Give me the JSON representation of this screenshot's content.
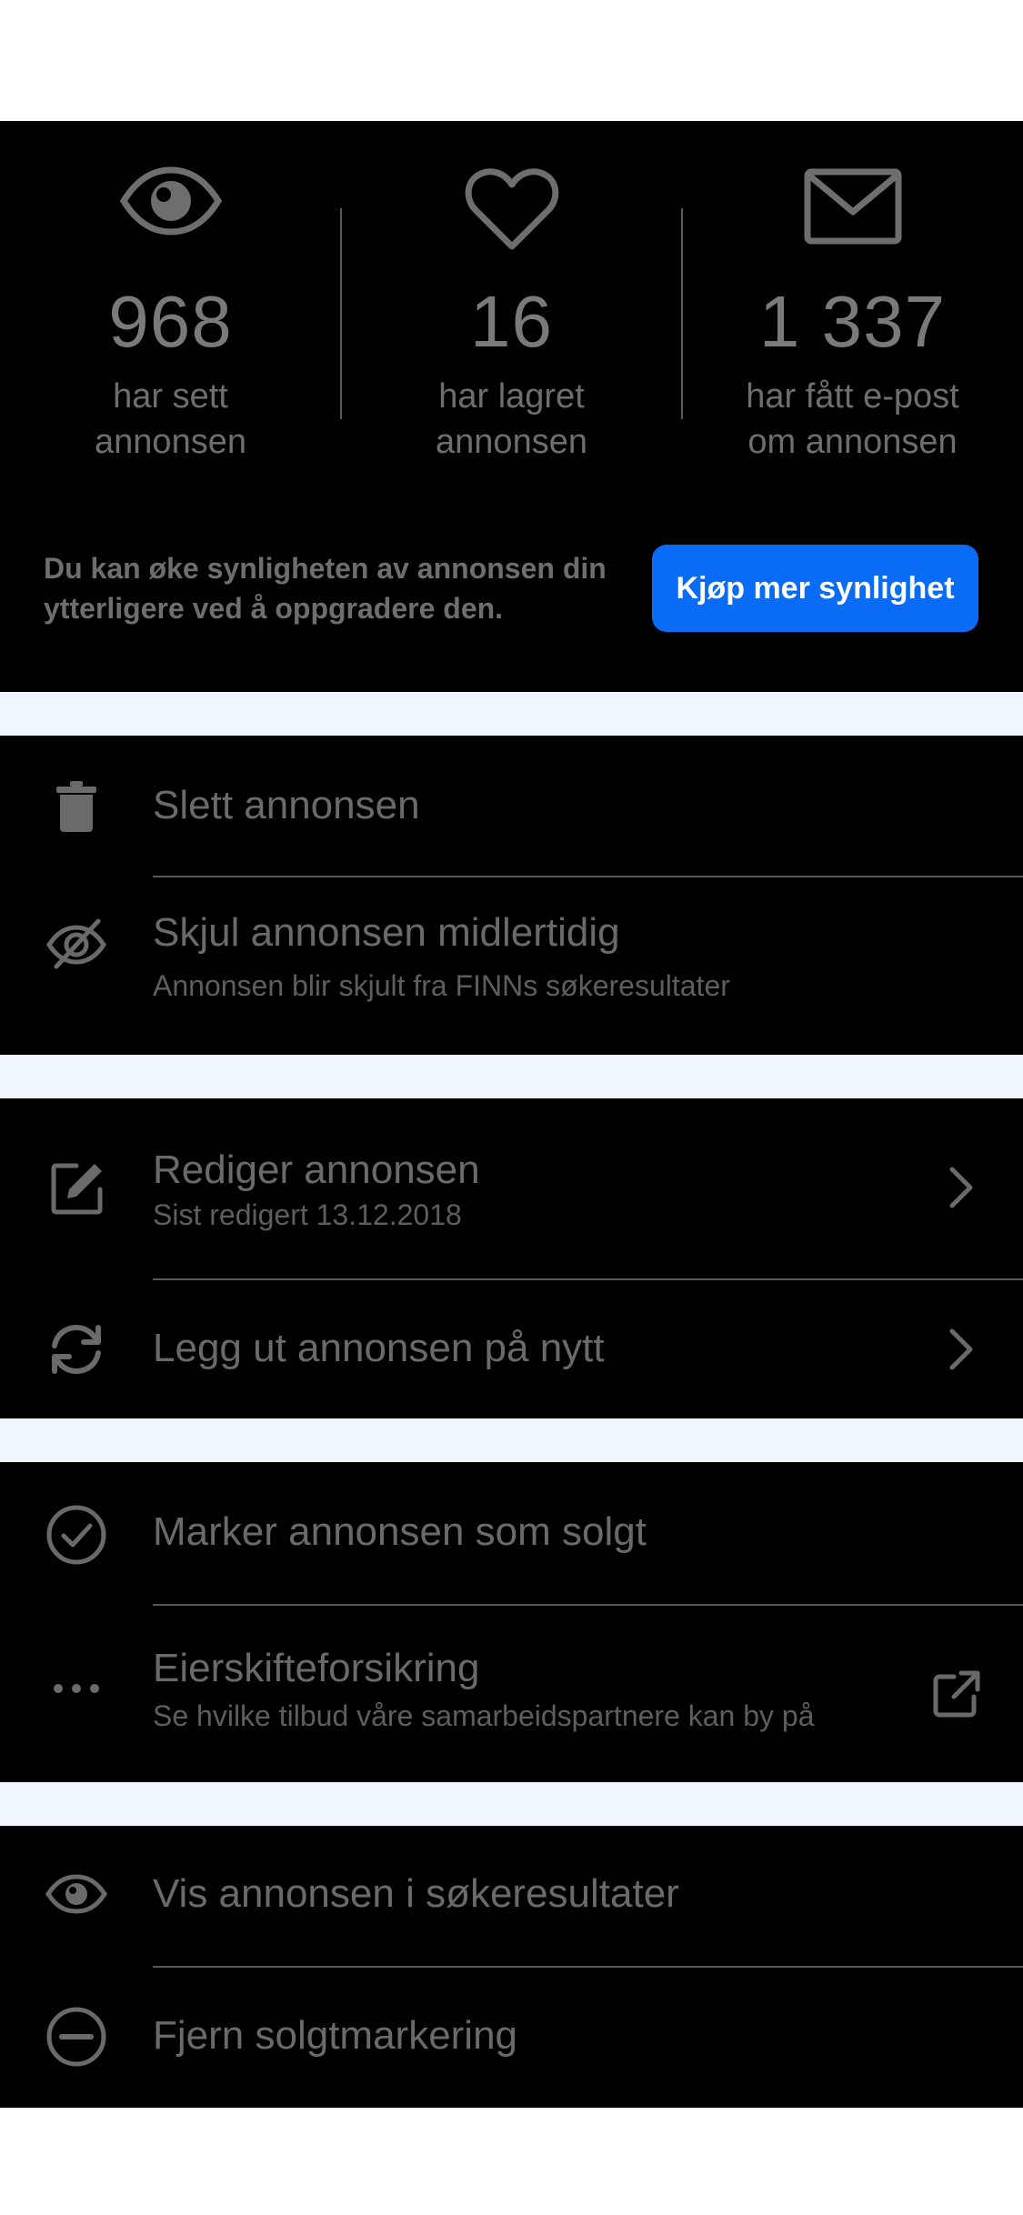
{
  "stats": [
    {
      "icon": "eye-icon",
      "value": "968",
      "label_line1": "har sett",
      "label_line2": "annonsen"
    },
    {
      "icon": "heart-icon",
      "value": "16",
      "label_line1": "har lagret",
      "label_line2": "annonsen"
    },
    {
      "icon": "envelope-icon",
      "value": "1 337",
      "label_line1": "har fått e-post",
      "label_line2": "om annonsen"
    }
  ],
  "promo": {
    "text": "Du kan øke synligheten av annonsen din ytterligere ved å oppgradere den.",
    "button_label": "Kjøp mer synlighet"
  },
  "actions": {
    "delete": {
      "title": "Slett annonsen"
    },
    "hide": {
      "title": "Skjul annonsen midlertidig",
      "subtitle": "Annonsen blir skjult fra FINNs søkeresultater"
    },
    "edit": {
      "title": "Rediger annonsen",
      "subtitle": "Sist redigert 13.12.2018"
    },
    "republish": {
      "title": "Legg ut annonsen på nytt"
    },
    "mark_sold": {
      "title": "Marker annonsen som solgt"
    },
    "insurance": {
      "title": "Eierskifteforsikring",
      "subtitle": "Se hvilke tilbud våre samarbeidspartnere kan by på"
    },
    "show_in_results": {
      "title": "Vis annonsen i søkeresultater"
    },
    "remove_sold": {
      "title": "Fjern solgtmarkering"
    }
  },
  "colors": {
    "accent": "#0a6cf5",
    "background": "#000000",
    "separator": "#eef5fd",
    "text": "#6a6a6a"
  }
}
